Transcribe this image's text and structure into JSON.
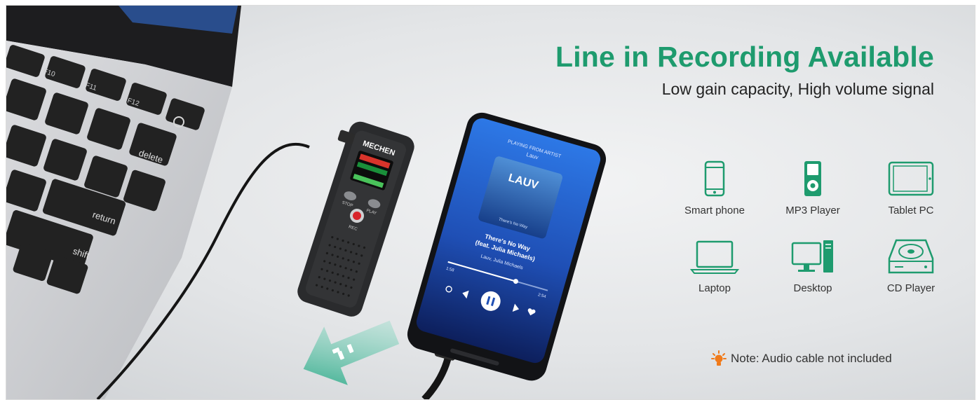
{
  "banner": {
    "title": "Line in Recording Available",
    "subtitle": "Low gain capacity, High volume signal",
    "note": "Note: Audio cable not  included",
    "accent_color": "#1e9b6e"
  },
  "devices": [
    {
      "label": "Smart phone",
      "icon": "smartphone-icon"
    },
    {
      "label": "MP3 Player",
      "icon": "mp3-player-icon"
    },
    {
      "label": "Tablet PC",
      "icon": "tablet-icon"
    },
    {
      "label": "Laptop",
      "icon": "laptop-icon"
    },
    {
      "label": "Desktop",
      "icon": "desktop-icon"
    },
    {
      "label": "CD Player",
      "icon": "cd-player-icon"
    }
  ],
  "laptop_keys": {
    "f10": "F10",
    "f11": "F11",
    "f12": "F12",
    "delete": "delete",
    "return": "return",
    "shift": "shift"
  },
  "recorder": {
    "brand": "MECHEN",
    "buttons": [
      "STOP",
      "PLAY",
      "REC"
    ]
  },
  "phone": {
    "header": "PLAYING FROM ARTIST",
    "artist": "Lauv",
    "album_art_text": "LAUV",
    "album_caption": "There's No Way",
    "song_title": "There's No Way",
    "song_feat": "(feat. Julia Michaels)",
    "song_artists": "Lauv, Julia Michaels",
    "time_elapsed": "1:58",
    "time_total": "2:54",
    "progress": 0.68
  }
}
